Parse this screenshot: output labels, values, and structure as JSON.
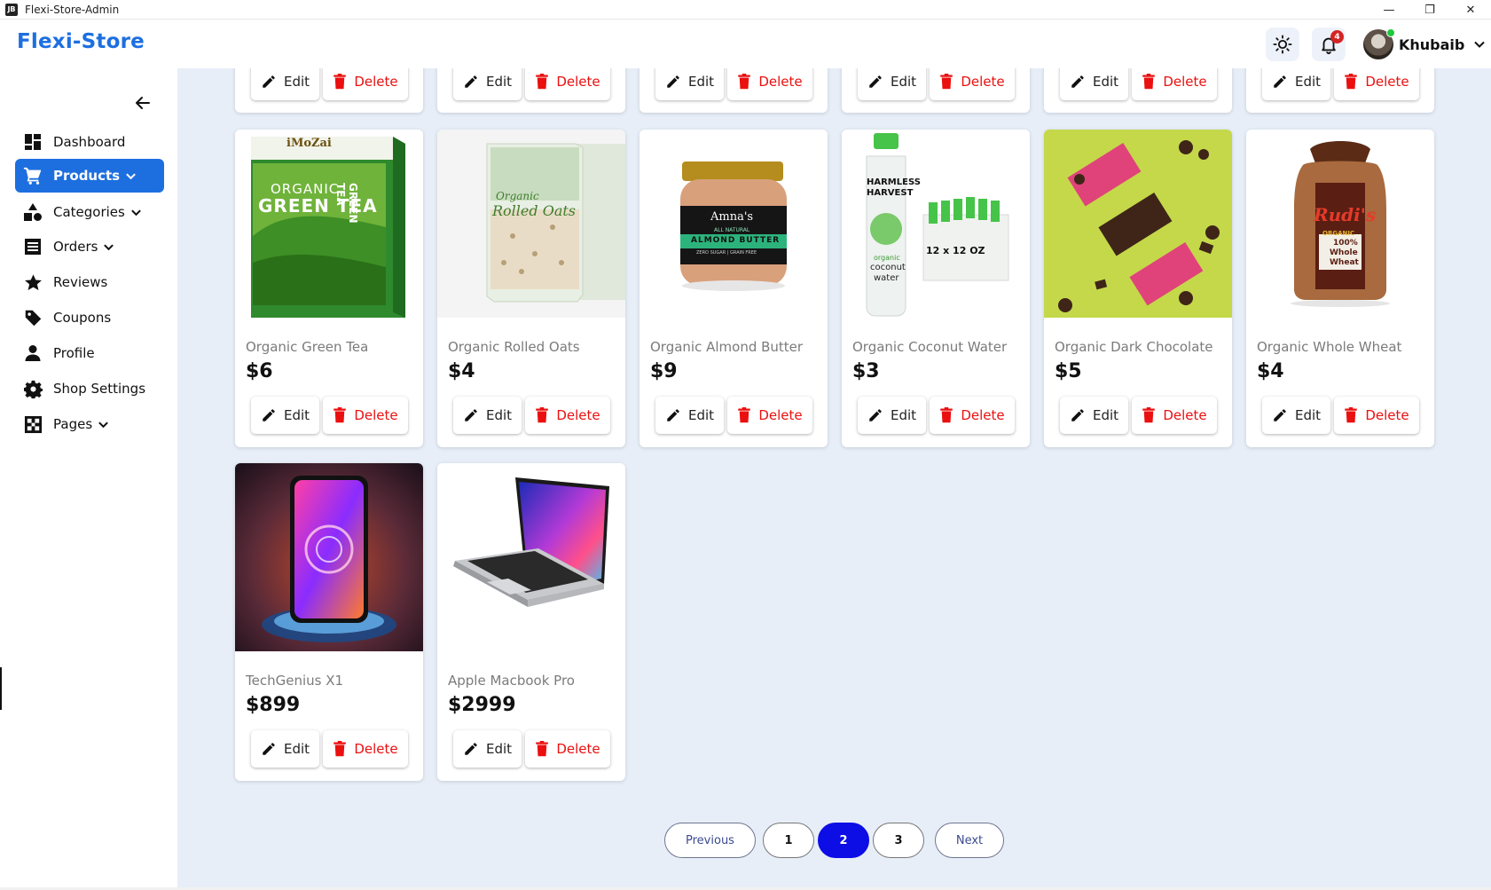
{
  "window": {
    "title": "Flexi-Store-Admin",
    "app_icon_text": "JB",
    "minimize": "—",
    "restore": "❐",
    "close": "✕"
  },
  "header": {
    "brand": "Flexi-Store",
    "notification_count": "4",
    "user_name": "Khubaib"
  },
  "sidebar": {
    "items": [
      {
        "label": "Dashboard",
        "icon": "dashboard-icon"
      },
      {
        "label": "Products",
        "icon": "cart-icon"
      },
      {
        "label": "Categories",
        "icon": "shapes-icon"
      },
      {
        "label": "Orders",
        "icon": "list-icon"
      },
      {
        "label": "Reviews",
        "icon": "star-icon"
      },
      {
        "label": "Coupons",
        "icon": "tag-icon"
      },
      {
        "label": "Profile",
        "icon": "person-icon"
      },
      {
        "label": "Shop Settings",
        "icon": "gear-icon"
      },
      {
        "label": "Pages",
        "icon": "puzzle-icon"
      }
    ]
  },
  "buttons": {
    "edit": "Edit",
    "delete": "Delete"
  },
  "products": [
    {
      "name": "Organic Green Tea",
      "price": "$6"
    },
    {
      "name": "Organic Rolled Oats",
      "price": "$4"
    },
    {
      "name": "Organic Almond Butter",
      "price": "$9"
    },
    {
      "name": "Organic Coconut Water",
      "price": "$3"
    },
    {
      "name": "Organic Dark Chocolate",
      "price": "$5"
    },
    {
      "name": "Organic Whole Wheat",
      "price": "$4"
    },
    {
      "name": "TechGenius X1",
      "price": "$899"
    },
    {
      "name": "Apple Macbook Pro",
      "price": "$2999"
    }
  ],
  "product_images": {
    "green_tea": {
      "brand": "iMoZai",
      "line1": "ORGANIC",
      "line2": "GREEN TEA",
      "side": "GREEN TEA"
    },
    "oats": {
      "line1": "Organic",
      "line2": "Rolled Oats"
    },
    "almond": {
      "brand": "Amna's",
      "line1": "ALL NATURAL",
      "line2": "ALMOND BUTTER",
      "line3": "ZERO SUGAR | GRAIN FREE"
    },
    "coconut": {
      "line1": "HARMLESS",
      "line2": "HARVEST",
      "line3": "organic",
      "line4": "coconut",
      "line5": "water",
      "pack": "12 x 12 OZ"
    },
    "bread": {
      "brand": "Rudi's",
      "line1": "ORGANIC",
      "line2": "100%",
      "line3": "Whole",
      "line4": "Wheat"
    }
  },
  "pagination": {
    "previous": "Previous",
    "pages": [
      "1",
      "2",
      "3"
    ],
    "current": "2",
    "next": "Next"
  },
  "colors": {
    "brand": "#1d6fe0",
    "active_page": "#0d0de6",
    "delete": "#ea1010",
    "content_bg": "#e7eef8"
  }
}
